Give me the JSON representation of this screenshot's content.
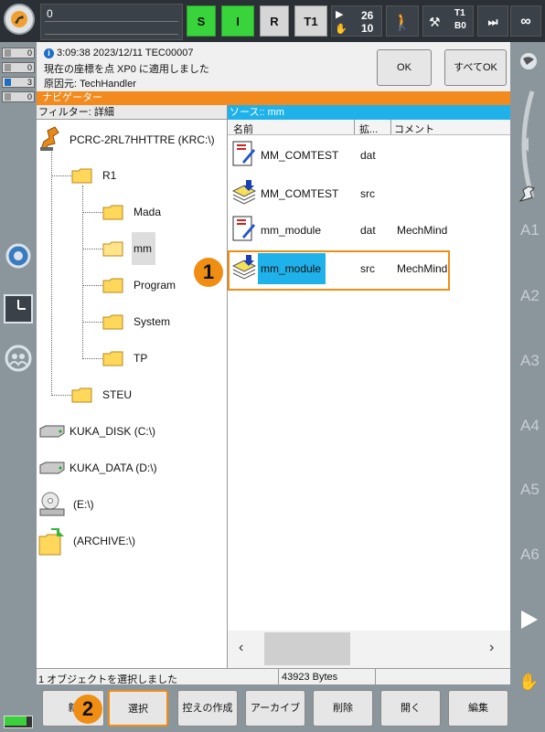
{
  "topbar": {
    "program_number": "0",
    "buttons": [
      {
        "label": "S",
        "style": "green"
      },
      {
        "label": "I",
        "style": "green"
      },
      {
        "label": "R",
        "style": "grey"
      },
      {
        "label": "T1",
        "style": "grey"
      }
    ],
    "override_program": "26",
    "override_jog": "10",
    "tool_label": "T1",
    "base_label": "B0",
    "infinity_label": "∞"
  },
  "left_indicators": [
    "0",
    "0",
    "3",
    "0"
  ],
  "message": {
    "line1": "3:09:38 2023/12/11 TEC00007",
    "line2": "現在の座標を点 XP0 に適用しました",
    "line3": "原因元: TechHandler",
    "ok_label": "OK",
    "all_ok_label": "すべてOK"
  },
  "navigator": {
    "title": "ナビゲーター",
    "filter": "フィルター: 詳細",
    "source": "ソース:: mm",
    "tree": {
      "root": "PCRC-2RL7HHTTRE (KRC:\\)",
      "r1": "R1",
      "mada": "Mada",
      "mm": "mm",
      "program": "Program",
      "system": "System",
      "tp": "TP",
      "steu": "STEU",
      "kuka_disk": "KUKA_DISK (C:\\)",
      "kuka_data": "KUKA_DATA (D:\\)",
      "e_drive": "(E:\\)",
      "archive": "(ARCHIVE:\\)"
    },
    "columns": [
      "名前",
      "拡...",
      "コメント"
    ],
    "files": [
      {
        "name": "MM_COMTEST",
        "ext": "dat",
        "comment": ""
      },
      {
        "name": "MM_COMTEST",
        "ext": "src",
        "comment": ""
      },
      {
        "name": "mm_module",
        "ext": "dat",
        "comment": "MechMind"
      },
      {
        "name": "mm_module",
        "ext": "src",
        "comment": "MechMind"
      }
    ]
  },
  "status": {
    "selection": "1 オブジェクトを選択しました",
    "size": "43923 Bytes"
  },
  "bottom_buttons": [
    "新",
    "選択",
    "控えの作成",
    "アーカイブ",
    "削除",
    "開く",
    "編集"
  ],
  "right_axes": [
    "A1",
    "A2",
    "A3",
    "A4",
    "A5",
    "A6"
  ],
  "callouts": [
    "1",
    "2"
  ],
  "colors": {
    "accent": "#f08e13",
    "selection": "#1fb2ea",
    "navbar": "#f28a1d",
    "green": "#39d33c"
  }
}
